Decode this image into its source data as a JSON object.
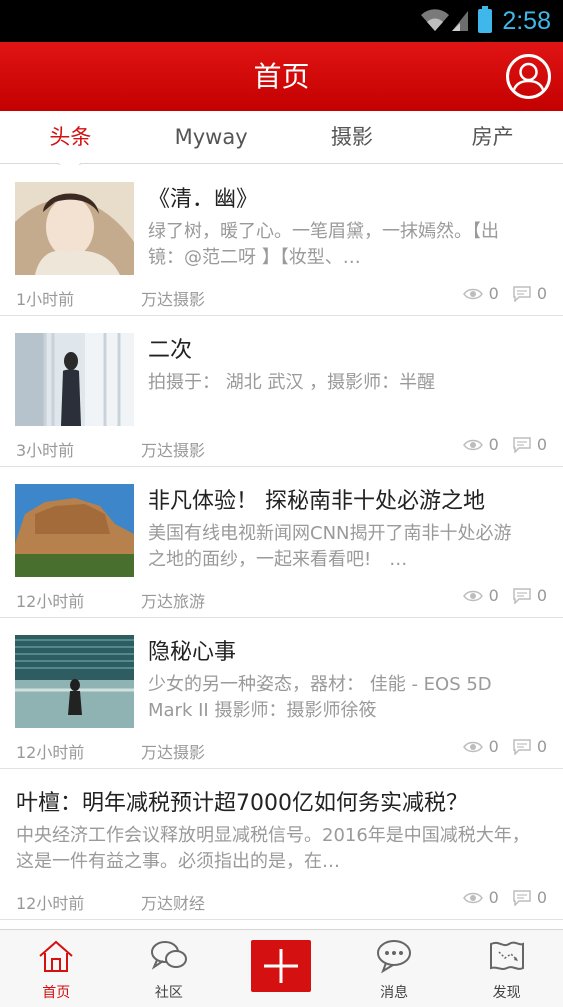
{
  "status_bar": {
    "time": "2:58"
  },
  "header": {
    "title": "首页"
  },
  "tabs": [
    {
      "label": "头条",
      "active": true
    },
    {
      "label": "Myway",
      "active": false
    },
    {
      "label": "摄影",
      "active": false
    },
    {
      "label": "房产",
      "active": false
    }
  ],
  "feed": [
    {
      "title": "《清．幽》",
      "desc": "绿了树，暖了心。一笔眉黛，一抹嫣然。【出镜：@范二呀 】【妆型、…",
      "time": "1小时前",
      "source": "万达摄影",
      "views": "0",
      "comments": "0"
    },
    {
      "title": "二次",
      "desc": "拍摄于： 湖北 武汉 ，摄影师：半醒",
      "time": "3小时前",
      "source": "万达摄影",
      "views": "0",
      "comments": "0"
    },
    {
      "title": "非凡体验！ 探秘南非十处必游之地",
      "desc": "美国有线电视新闻网CNN揭开了南非十处必游之地的面纱，一起来看看吧!　…",
      "time": "12小时前",
      "source": "万达旅游",
      "views": "0",
      "comments": "0"
    },
    {
      "title": "隐秘心事",
      "desc": "少女的另一种姿态，器材： 佳能 - EOS 5D Mark II 摄影师：摄影师徐筱",
      "time": "12小时前",
      "source": "万达摄影",
      "views": "0",
      "comments": "0"
    },
    {
      "title": "叶檀：明年减税预计超7000亿如何务实减税？",
      "desc": "中央经济工作会议释放明显减税信号。2016年是中国减税大年，这是一件有益之事。必须指出的是，在…",
      "time": "12小时前",
      "source": "万达财经",
      "views": "0",
      "comments": "0"
    }
  ],
  "bottom_nav": [
    {
      "label": "首页",
      "icon": "home-icon",
      "active": true
    },
    {
      "label": "社区",
      "icon": "chat-bubbles-icon",
      "active": false
    },
    {
      "label": "",
      "icon": "plus-icon",
      "active": false
    },
    {
      "label": "消息",
      "icon": "message-icon",
      "active": false
    },
    {
      "label": "发现",
      "icon": "map-icon",
      "active": false
    }
  ],
  "colors": {
    "brand_red": "#d41010",
    "status_blue": "#3fb7ea",
    "muted_text": "#999999"
  }
}
